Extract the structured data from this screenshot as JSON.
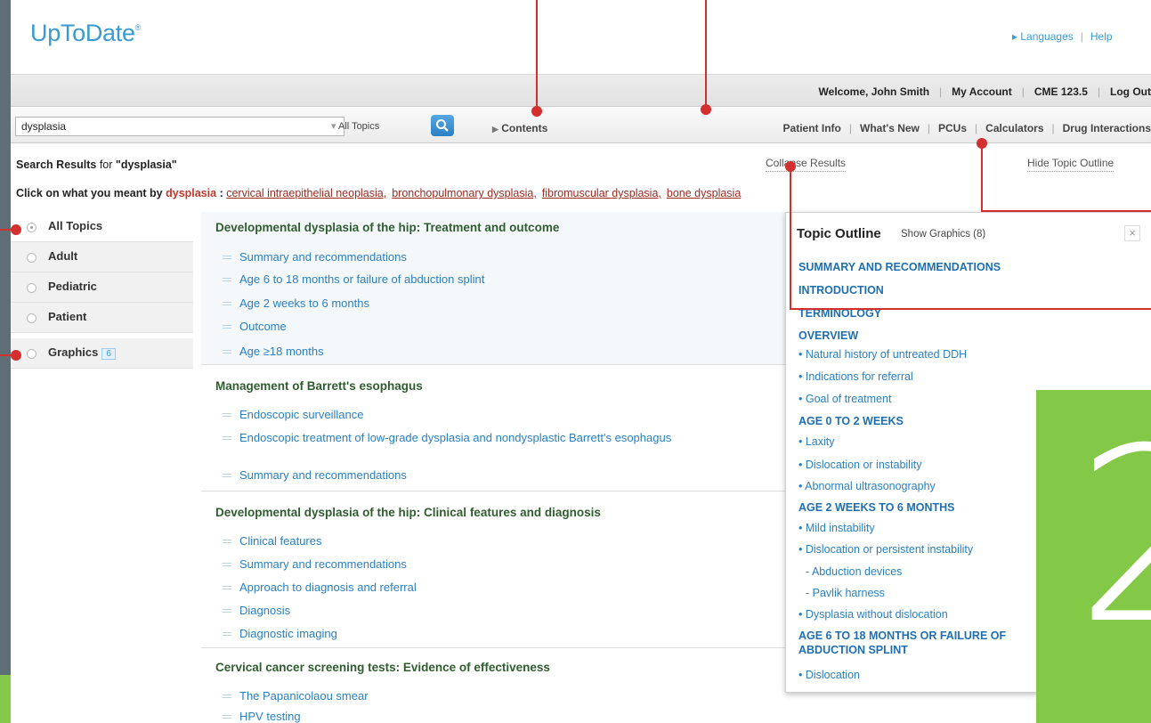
{
  "header": {
    "logo": "UpToDate",
    "logo_mark": "®",
    "languages": "Languages",
    "help": "Help"
  },
  "user_bar": {
    "welcome_prefix": "Welcome,",
    "user_name": "John Smith",
    "my_account": "My Account",
    "cme": "CME 123.5",
    "log_out": "Log Out"
  },
  "toolbar": {
    "search_value": "dysplasia",
    "topic_filter": "All Topics",
    "contents": "Contents",
    "nav": [
      "Patient Info",
      "What's New",
      "PCUs",
      "Calculators",
      "Drug Interactions"
    ]
  },
  "results_header": {
    "label": "Search Results",
    "for": "for",
    "query": "\"dysplasia\"",
    "collapse": "Collapse Results",
    "hide_outline": "Hide Topic Outline"
  },
  "meant": {
    "prefix": "Click on what you meant by",
    "term": "dysplasia",
    "colon": ":",
    "options": [
      "cervical intraepithelial neoplasia,",
      "bronchopulmonary dysplasia,",
      "fibromuscular dysplasia,",
      "bone dysplasia"
    ]
  },
  "sidebar": {
    "items": [
      {
        "label": "All Topics"
      },
      {
        "label": "Adult"
      },
      {
        "label": "Pediatric"
      },
      {
        "label": "Patient"
      },
      {
        "label": "Graphics",
        "badge": "6"
      }
    ]
  },
  "results": [
    {
      "title": "Developmental dysplasia of the hip: Treatment and outcome",
      "items": [
        "Summary and recommendations",
        "Age 6 to 18 months or failure of abduction splint",
        "Age 2 weeks to 6 months",
        "Outcome",
        "Age ≥18 months"
      ]
    },
    {
      "title": "Management of Barrett's esophagus",
      "items": [
        "Endoscopic surveillance",
        "Endoscopic treatment of low-grade dysplasia and nondysplastic Barrett's esophagus",
        "Summary and recommendations"
      ]
    },
    {
      "title": "Developmental dysplasia of the hip: Clinical features and diagnosis",
      "items": [
        "Clinical features",
        "Summary and recommendations",
        "Approach to diagnosis and referral",
        "Diagnosis",
        "Diagnostic imaging"
      ]
    },
    {
      "title": "Cervical cancer screening tests: Evidence of effectiveness",
      "items": [
        "The Papanicolaou smear",
        "HPV testing"
      ]
    }
  ],
  "outline": {
    "title": "Topic Outline",
    "show_graphics": "Show Graphics (8)",
    "close": "×",
    "entries": [
      "SUMMARY AND RECOMMENDATIONS",
      "INTRODUCTION",
      "TERMINOLOGY",
      "OVERVIEW",
      "• Natural history of untreated DDH",
      "• Indications for referral",
      "• Goal of treatment",
      "AGE 0 TO 2 WEEKS",
      "• Laxity",
      "• Dislocation or instability",
      "• Abnormal ultrasonography",
      "AGE 2 WEEKS TO 6 MONTHS",
      "• Mild instability",
      "• Dislocation or persistent instability",
      "- Abduction devices",
      "- Pavlik harness",
      "• Dysplasia without dislocation",
      "AGE 6 TO 18 MONTHS OR FAILURE OF",
      "ABDUCTION SPLINT",
      "• Dislocation"
    ]
  },
  "overlay": {
    "step_number": "2",
    "accent_color": "#84c847",
    "callout_color": "#d32f2f"
  }
}
